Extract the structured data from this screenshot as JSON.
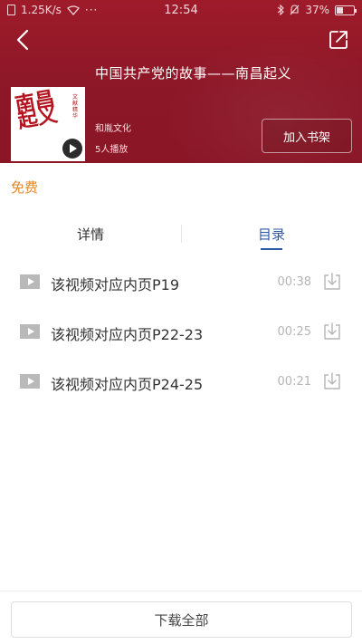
{
  "status_bar": {
    "speed": "1.25K/s",
    "time": "12:54",
    "battery": "37%"
  },
  "book": {
    "title": "中国共产党的故事——南昌起义",
    "cover_text": "南昌起义",
    "cover_side_text": "文献精华",
    "publisher": "和胤文化",
    "plays": "5人播放"
  },
  "actions": {
    "add_shelf_label": "加入书架",
    "download_all_label": "下载全部"
  },
  "price_label": "免费",
  "tabs": [
    {
      "label": "详情",
      "selected": false
    },
    {
      "label": "目录",
      "selected": true
    }
  ],
  "episodes": [
    {
      "title": "该视频对应内页P19",
      "duration": "00:38"
    },
    {
      "title": "该视频对应内页P22-23",
      "duration": "00:25"
    },
    {
      "title": "该视频对应内页P24-25",
      "duration": "00:21"
    }
  ],
  "colors": {
    "header_red": "#8c1727",
    "accent_blue": "#2b5aa8",
    "free_orange": "#e08a2b"
  }
}
